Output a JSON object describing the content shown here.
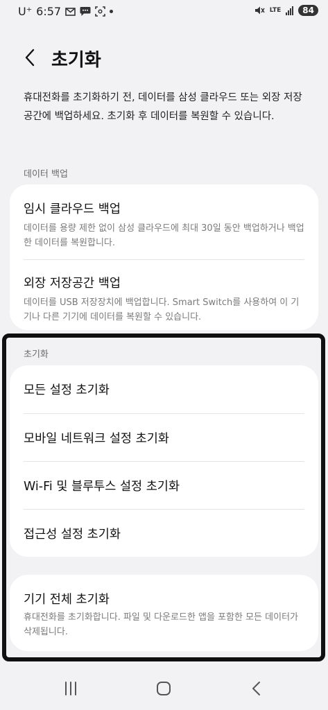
{
  "status_bar": {
    "carrier": "U⁺",
    "time": "6:57",
    "icons_left": [
      "mail-icon",
      "chat-icon",
      "screenshot-icon"
    ],
    "lte": "LTE",
    "battery": "84"
  },
  "header": {
    "title": "초기화"
  },
  "intro": "휴대전화를 초기화하기 전, 데이터를 삼성 클라우드 또는 외장 저장공간에 백업하세요. 초기화 후 데이터를 복원할 수 있습니다.",
  "backup_section": {
    "label": "데이터 백업",
    "items": [
      {
        "title": "임시 클라우드 백업",
        "subtitle": "데이터를 용량 제한 없이 삼성 클라우드에 최대 30일 동안 백업하거나 백업한 데이터를 복원합니다."
      },
      {
        "title": "외장 저장공간 백업",
        "subtitle": "데이터를 USB 저장장치에 백업합니다. Smart Switch를 사용하여 이 기기나 다른 기기에 데이터를 복원할 수 있습니다."
      }
    ]
  },
  "reset_section": {
    "label": "초기화",
    "items": [
      {
        "title": "모든 설정 초기화"
      },
      {
        "title": "모바일 네트워크 설정 초기화"
      },
      {
        "title": "Wi-Fi 및 블루투스 설정 초기화"
      },
      {
        "title": "접근성 설정 초기화"
      }
    ]
  },
  "factory_reset": {
    "title": "기기 전체 초기화",
    "subtitle": "휴대전화를 초기화합니다. 파일 및 다운로드한 앱을 포함한 모든 데이터가 삭제됩니다."
  },
  "nav": [
    "recent-apps-icon",
    "home-icon",
    "back-icon"
  ],
  "colors": {
    "background": "#f2f2f4",
    "card": "#ffffff",
    "highlight_border": "#101010",
    "subtext": "#7a7a7a"
  }
}
